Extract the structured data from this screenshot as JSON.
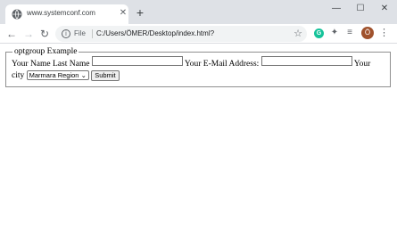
{
  "browser": {
    "tab": {
      "title": "www.systemconf.com",
      "close_glyph": "✕"
    },
    "new_tab_glyph": "+",
    "window_controls": {
      "minimize": "—",
      "maximize": "☐",
      "close": "✕"
    },
    "nav": {
      "back": "←",
      "forward": "→",
      "reload": "↻"
    },
    "omnibox": {
      "scheme_label": "File",
      "url": "C:/Users/ÖMER/Desktop/index.html?",
      "info_glyph": "i"
    },
    "star_glyph": "☆",
    "extensions": {
      "grammarly": "G",
      "puzzle": "✦",
      "queue": "≡"
    },
    "avatar_initial": "Ö",
    "menu_glyph": "⋮"
  },
  "page": {
    "legend": "optgroup Example",
    "name_label": "Your Name Last Name",
    "name_value": "",
    "email_label": "Your E-Mail Address:",
    "email_value": "",
    "city_label_part1": "Your",
    "city_label_part2": "city",
    "city_selected": "Marmara Region",
    "submit_label": "Submit"
  },
  "colors": {
    "tabstrip_bg": "#dee1e6",
    "omnibox_bg": "#f1f3f4",
    "grammarly": "#15c39a",
    "avatar": "#a0522d"
  }
}
